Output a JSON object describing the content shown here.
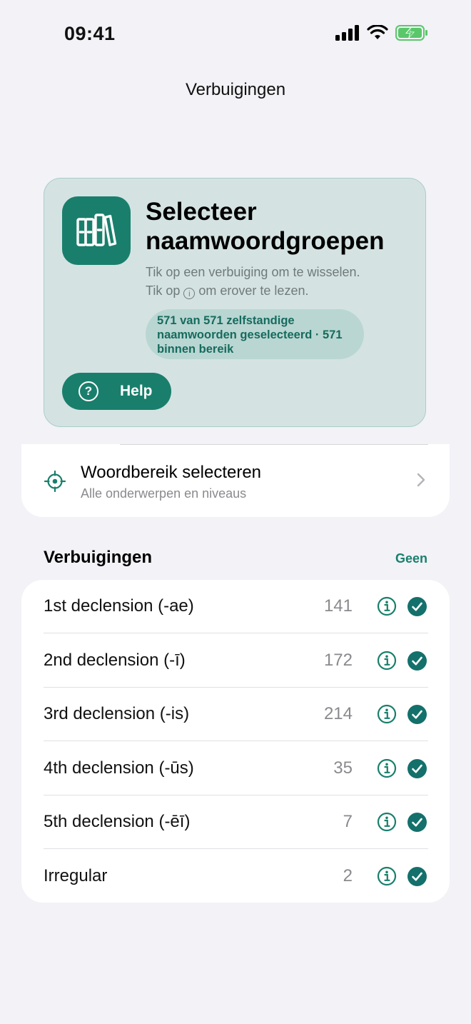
{
  "status_bar": {
    "time": "09:41"
  },
  "nav": {
    "title": "Verbuigingen"
  },
  "hero": {
    "icon": "books-icon",
    "title": "Selecteer naamwoordgroepen",
    "subtitle_line1": "Tik op een verbuiging om te wisselen.",
    "subtitle_line2_pre": "Tik op",
    "subtitle_line2_icon": "i",
    "subtitle_line2_post": "om erover te lezen.",
    "pill": "571 van 571 zelfstandige naamwoorden geselecteerd · 571 binnen bereik",
    "help_icon_glyph": "?",
    "help_label": "Help"
  },
  "range": {
    "icon": "crosshair-icon",
    "title": "Woordbereik selecteren",
    "subtitle": "Alle onderwerpen en niveaus"
  },
  "section": {
    "title": "Verbuigingen",
    "action": "Geen"
  },
  "declensions": [
    {
      "label": "1st declension (-ae)",
      "count": "141",
      "selected": true
    },
    {
      "label": "2nd declension (-ī)",
      "count": "172",
      "selected": true
    },
    {
      "label": "3rd declension (-is)",
      "count": "214",
      "selected": true
    },
    {
      "label": "4th declension (-ūs)",
      "count": "35",
      "selected": true
    },
    {
      "label": "5th declension (-ēī)",
      "count": "7",
      "selected": true
    },
    {
      "label": "Irregular",
      "count": "2",
      "selected": true
    }
  ],
  "colors": {
    "accent": "#197f6c",
    "check": "#14706b",
    "hero_bg": "#d4e3e2",
    "page_bg": "#f2f2f7"
  }
}
